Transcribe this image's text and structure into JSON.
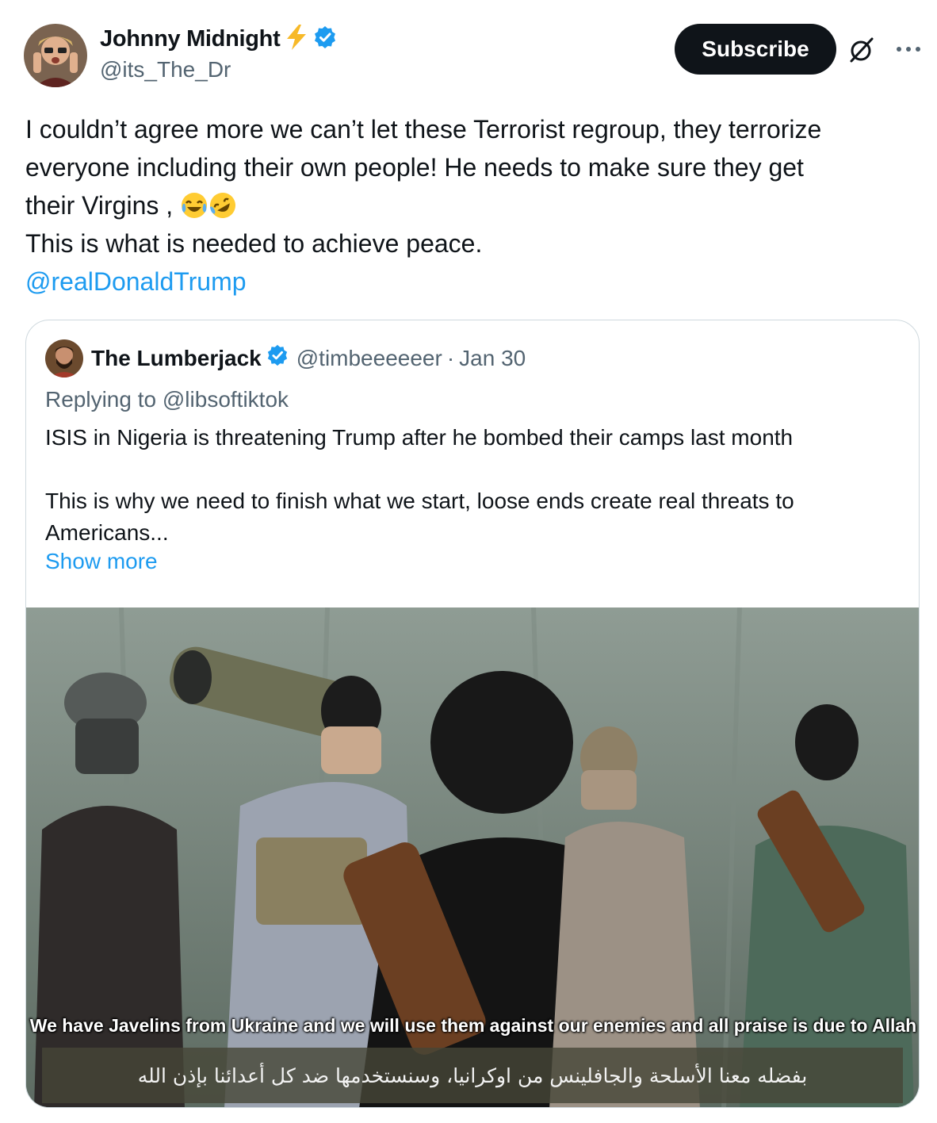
{
  "author": {
    "display_name": "Johnny Midnight",
    "handle": "@its_The_Dr",
    "icons": [
      "lightning-icon",
      "verified-badge-icon"
    ]
  },
  "actions": {
    "subscribe_label": "Subscribe",
    "grok_icon": "grok-icon",
    "more_icon": "more-icon"
  },
  "tweet": {
    "line1": "I couldn’t agree more we can’t let these Terrorist regroup, they terrorize",
    "line2": "everyone including their own people! He needs to make sure they get",
    "line3": "their Virgins ,",
    "line3_emojis": [
      "tears-of-joy-emoji",
      "rolling-laughing-emoji"
    ],
    "line4": "This is what is needed to achieve peace.",
    "mention": "@realDonaldTrump"
  },
  "quoted": {
    "display_name": "The Lumberjack",
    "handle": "@timbeeeeeer",
    "separator": "·",
    "date": "Jan 30",
    "replying_prefix": "Replying to",
    "replying_to": "@libsoftiktok",
    "body_line1": "ISIS in Nigeria is threatening Trump after he bombed their camps last month",
    "body_line2": "This is why we need to finish what we start, loose ends create real threats to",
    "body_line3": "Americans...",
    "show_more": "Show more",
    "media": {
      "caption_english": "We have Javelins from Ukraine and we will use them against our enemies and all praise is due to Allah",
      "caption_arabic": "بفضله معنا الأسلحة والجافلينس من اوكرانيا، وسنستخدمها ضد كل أعدائنا بإذن الله"
    }
  },
  "colors": {
    "text": "#0f1419",
    "secondary": "#536471",
    "link": "#1d9bf0",
    "verified": "#1d9bf0",
    "lightning": "#f7b928",
    "button_bg": "#0f1419",
    "border": "#cfd9de"
  }
}
